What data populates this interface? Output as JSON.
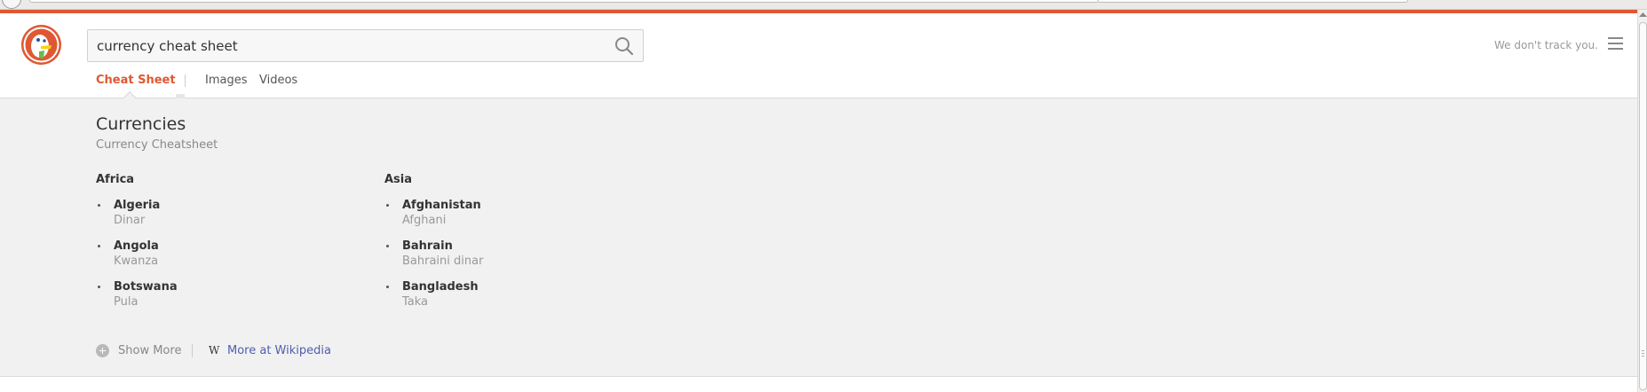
{
  "search": {
    "query": "currency cheat sheet"
  },
  "header": {
    "tagline": "We don't track you."
  },
  "tabs": [
    {
      "label": "Cheat Sheet"
    },
    {
      "label": "Images"
    },
    {
      "label": "Videos"
    }
  ],
  "cheatsheet": {
    "title": "Currencies",
    "subtitle": "Currency Cheatsheet",
    "regions": [
      {
        "name": "Africa",
        "items": [
          {
            "country": "Algeria",
            "currency": "Dinar"
          },
          {
            "country": "Angola",
            "currency": "Kwanza"
          },
          {
            "country": "Botswana",
            "currency": "Pula"
          }
        ]
      },
      {
        "name": "Asia",
        "items": [
          {
            "country": "Afghanistan",
            "currency": "Afghani"
          },
          {
            "country": "Bahrain",
            "currency": "Bahraini dinar"
          },
          {
            "country": "Bangladesh",
            "currency": "Taka"
          }
        ]
      }
    ],
    "footer": {
      "show_more": "Show More",
      "wiki_link": "More at Wikipedia"
    }
  },
  "colors": {
    "brand": "#de5833",
    "link": "#4f5db0",
    "panel_bg": "#f1f1f1"
  }
}
